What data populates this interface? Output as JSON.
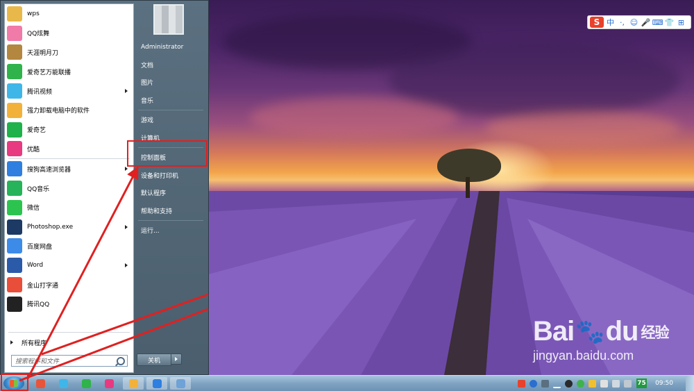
{
  "start_menu": {
    "programs": [
      {
        "label": "wps",
        "icon": "folder-icon",
        "color": "#e8b94a",
        "has_arrow": false
      },
      {
        "label": "QQ炫舞",
        "icon": "qq-dance-icon",
        "color": "#f07aa8",
        "has_arrow": false
      },
      {
        "label": "天涯明月刀",
        "icon": "tianya-icon",
        "color": "#b3873f",
        "has_arrow": false
      },
      {
        "label": "爱奇艺万能联播",
        "icon": "iqiyi-player-icon",
        "color": "#2fb34a",
        "has_arrow": false
      },
      {
        "label": "腾讯视频",
        "icon": "tencent-video-icon",
        "color": "#3fb6e8",
        "has_arrow": true
      },
      {
        "label": "强力卸载电脑中的软件",
        "icon": "uninstall-icon",
        "color": "#f2b23a",
        "has_arrow": false
      },
      {
        "label": "爱奇艺",
        "icon": "iqiyi-icon",
        "color": "#1fb14a",
        "has_arrow": false
      },
      {
        "label": "优酷",
        "icon": "youku-icon",
        "color": "#e83a80",
        "has_arrow": false
      },
      {
        "label": "搜狗高速浏览器",
        "icon": "sogou-browser-icon",
        "color": "#2f7fe0",
        "has_arrow": true
      },
      {
        "label": "QQ音乐",
        "icon": "qq-music-icon",
        "color": "#26b35a",
        "has_arrow": false
      },
      {
        "label": "微信",
        "icon": "wechat-icon",
        "color": "#2cc44f",
        "has_arrow": false
      },
      {
        "label": "Photoshop.exe",
        "icon": "photoshop-icon",
        "color": "#1c3a63",
        "has_arrow": true
      },
      {
        "label": "百度网盘",
        "icon": "baidu-netdisk-icon",
        "color": "#3d8be8",
        "has_arrow": false
      },
      {
        "label": "Word",
        "icon": "word-icon",
        "color": "#2b5ba8",
        "has_arrow": true
      },
      {
        "label": "金山打字通",
        "icon": "typing-icon",
        "color": "#e94e3a",
        "has_arrow": false
      },
      {
        "label": "腾讯QQ",
        "icon": "qq-icon",
        "color": "#222222",
        "has_arrow": false
      }
    ],
    "all_programs": "所有程序",
    "search_placeholder": "搜索程序和文件",
    "user_name": "Administrator",
    "right_group1": [
      "文档",
      "图片",
      "音乐"
    ],
    "right_group2": [
      "游戏",
      "计算机"
    ],
    "right_group3": [
      "控制面板",
      "设备和打印机",
      "默认程序",
      "帮助和支持"
    ],
    "run": "运行...",
    "shutdown": "关机"
  },
  "ime": {
    "logo": "S",
    "items": [
      "中",
      "·,",
      "☺",
      "🎤",
      "⌨",
      "👕",
      "⊞"
    ]
  },
  "watermark": {
    "main_left": "Bai",
    "paw": "🐾",
    "main_right": "du",
    "sub": "经验",
    "url": "jingyan.baidu.com"
  },
  "taskbar": {
    "clock": "09:50",
    "badge": "75"
  },
  "colors": {
    "highlight": "#e02020"
  }
}
